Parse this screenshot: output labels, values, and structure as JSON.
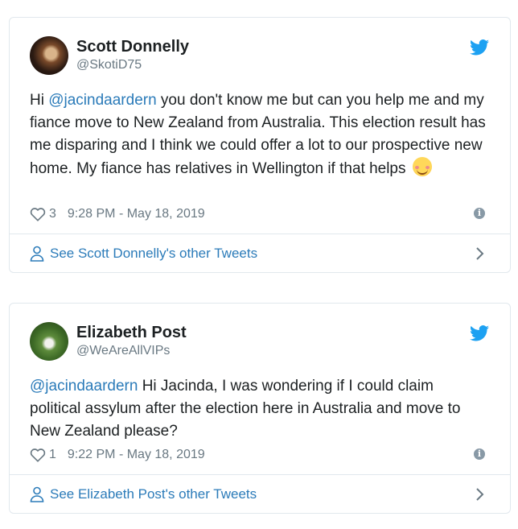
{
  "tweets": [
    {
      "name": "Scott Donnelly",
      "handle": "@SkotiD75",
      "text_parts": {
        "before": "Hi ",
        "mention": "@jacindaardern",
        "after": " you don't know me but can you help me and my fiance move to New Zealand from Australia. This election result has me disparing and I think we could offer a lot to our prospective new home. My fiance has relatives in Wellington if that helps"
      },
      "emoji": "smiling-face-icon",
      "likes": "3",
      "timestamp": "9:28 PM - May 18, 2019",
      "footer_link": "See Scott Donnelly's other Tweets"
    },
    {
      "name": "Elizabeth Post",
      "handle": "@WeAreAllVIPs",
      "text_parts": {
        "before": "",
        "mention": "@jacindaardern",
        "after": " Hi Jacinda, I was wondering if I could claim political assylum after the election here in Australia and move to New Zealand please?"
      },
      "likes": "1",
      "timestamp": "9:22 PM - May 18, 2019",
      "footer_link": "See Elizabeth Post's other Tweets"
    }
  ],
  "colors": {
    "link": "#2b7bb9",
    "muted": "#697882",
    "twitter_blue": "#1da1f2",
    "border": "#e1e8ed"
  }
}
